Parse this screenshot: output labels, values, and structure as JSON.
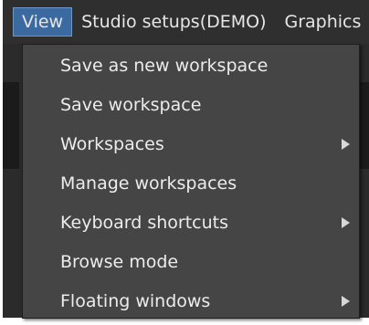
{
  "menubar": {
    "items": [
      {
        "label": "View",
        "active": true
      },
      {
        "label": "Studio setups(DEMO)",
        "active": false
      },
      {
        "label": "Graphics",
        "active": false
      }
    ]
  },
  "view_menu": {
    "items": [
      {
        "label": "Save as new workspace",
        "has_submenu": false
      },
      {
        "label": "Save workspace",
        "has_submenu": false
      },
      {
        "label": "Workspaces",
        "has_submenu": true,
        "icon": "chevron-right-icon"
      },
      {
        "label": "Manage workspaces",
        "has_submenu": false
      },
      {
        "label": "Keyboard shortcuts",
        "has_submenu": true,
        "icon": "chevron-right-icon"
      },
      {
        "label": "Browse mode",
        "has_submenu": false
      },
      {
        "label": "Floating windows",
        "has_submenu": true,
        "icon": "chevron-right-icon"
      }
    ]
  },
  "colors": {
    "menubar_bg": "#2f2f2f",
    "menu_bg": "#454545",
    "active_item_bg": "#3b6aa0",
    "text": "#ececec"
  }
}
